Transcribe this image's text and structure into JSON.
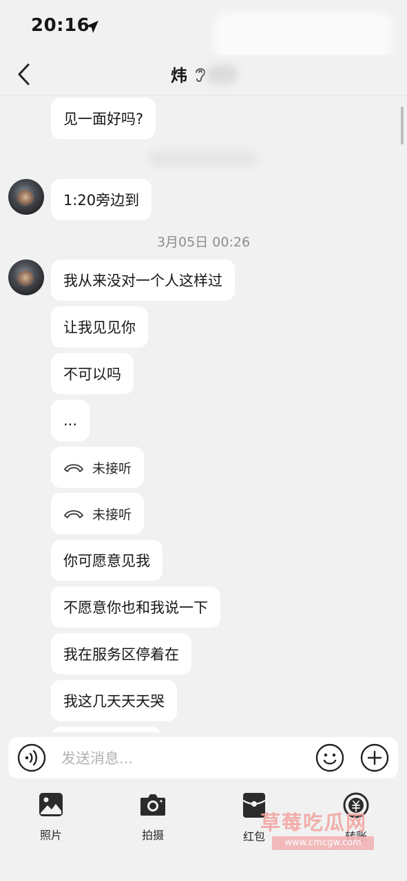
{
  "status_bar": {
    "time": "20:16"
  },
  "header": {
    "title": "炜"
  },
  "messages": [
    {
      "text": "见一面好吗?"
    },
    {
      "text": "1:20旁边到"
    },
    {
      "text": "我从来没对一个人这样过"
    },
    {
      "text": "让我见见你"
    },
    {
      "text": "不可以吗"
    },
    {
      "text": "..."
    },
    {
      "text": "未接听",
      "type": "missed-call"
    },
    {
      "text": "未接听",
      "type": "missed-call"
    },
    {
      "text": "你可愿意见我"
    },
    {
      "text": "不愿意你也和我说一下"
    },
    {
      "text": "我在服务区停着在"
    },
    {
      "text": "我这几天天天哭"
    }
  ],
  "timestamp": "3月05日 00:26",
  "input": {
    "placeholder": "发送消息..."
  },
  "toolbar": [
    {
      "label": "照片",
      "icon": "photo-icon"
    },
    {
      "label": "拍摄",
      "icon": "camera-icon"
    },
    {
      "label": "红包",
      "icon": "red-packet-icon"
    },
    {
      "label": "转账",
      "icon": "transfer-icon"
    }
  ],
  "watermark": {
    "text": "草莓吃瓜网",
    "url": "www.cmcgw.com"
  },
  "colors": {
    "background": "#f1f1f1",
    "bubble": "#ffffff",
    "timestamp": "#8c8c8c",
    "watermark": "#f2a7a3"
  }
}
